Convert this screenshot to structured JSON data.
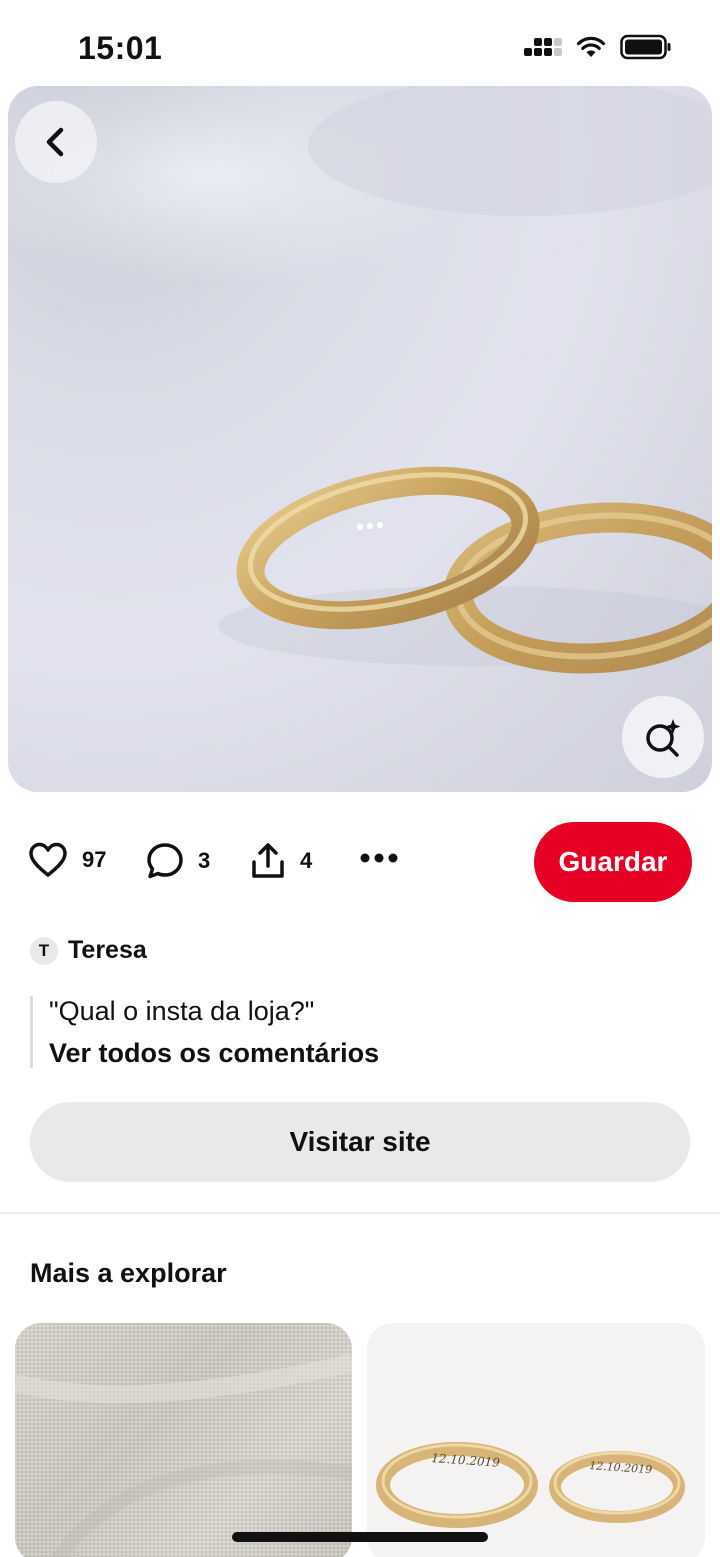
{
  "status_bar": {
    "time": "15:01"
  },
  "pin": {
    "image_alt": "Two gold wedding rings on a white surface",
    "stats": {
      "likes": "97",
      "comments": "3",
      "shares": "4"
    },
    "save_label": "Guardar",
    "author": {
      "initial": "T",
      "name": "Teresa"
    },
    "comment": {
      "text": "\"Qual o insta da loja?\"",
      "link": "Ver todos os comentários"
    },
    "visit_label": "Visitar site"
  },
  "explore": {
    "title": "Mais a explorar",
    "cards": [
      {
        "alt": "Linen fabric texture"
      },
      {
        "alt": "Engraved gold wedding rings",
        "engraving_left": "12.10.2019",
        "engraving_right": "12.10.2019"
      }
    ]
  },
  "colors": {
    "accent": "#e60023",
    "button_gray": "#e9e9e9",
    "gold": "#c9a45e"
  },
  "icons": [
    "back-arrow-icon",
    "visual-search-icon",
    "heart-icon",
    "comment-icon",
    "share-icon",
    "more-icon"
  ]
}
